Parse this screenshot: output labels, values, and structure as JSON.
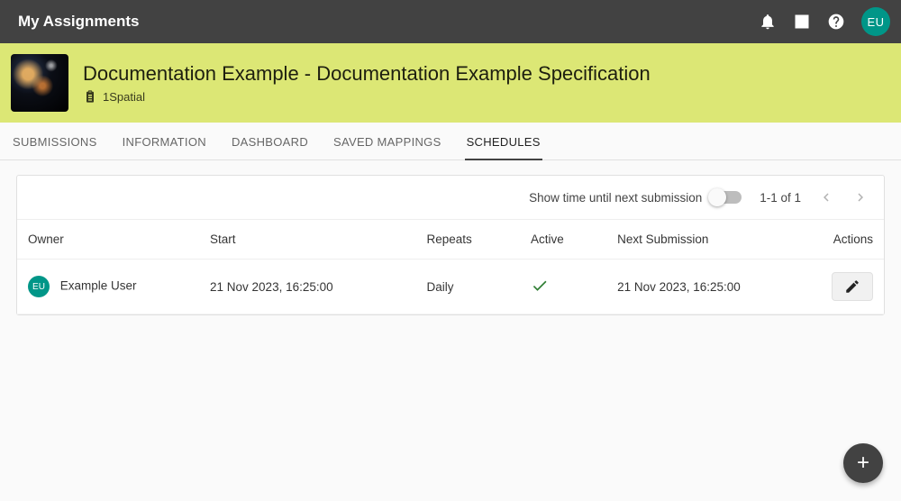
{
  "topbar": {
    "title": "My Assignments",
    "user_initials": "EU"
  },
  "hero": {
    "title": "Documentation Example - Documentation Example Specification",
    "org": "1Spatial"
  },
  "tabs": [
    {
      "label": "SUBMISSIONS"
    },
    {
      "label": "INFORMATION"
    },
    {
      "label": "DASHBOARD"
    },
    {
      "label": "SAVED MAPPINGS"
    },
    {
      "label": "SCHEDULES"
    }
  ],
  "active_tab_index": 4,
  "toolbar": {
    "toggle_label": "Show time until next submission",
    "pager_label": "1-1 of 1"
  },
  "table": {
    "columns": {
      "owner": "Owner",
      "start": "Start",
      "repeats": "Repeats",
      "active": "Active",
      "next": "Next Submission",
      "actions": "Actions"
    },
    "rows": [
      {
        "owner_initials": "EU",
        "owner_name": "Example User",
        "start": "21 Nov 2023, 16:25:00",
        "repeats": "Daily",
        "active": true,
        "next": "21 Nov 2023, 16:25:00"
      }
    ]
  },
  "fab_label": "+"
}
